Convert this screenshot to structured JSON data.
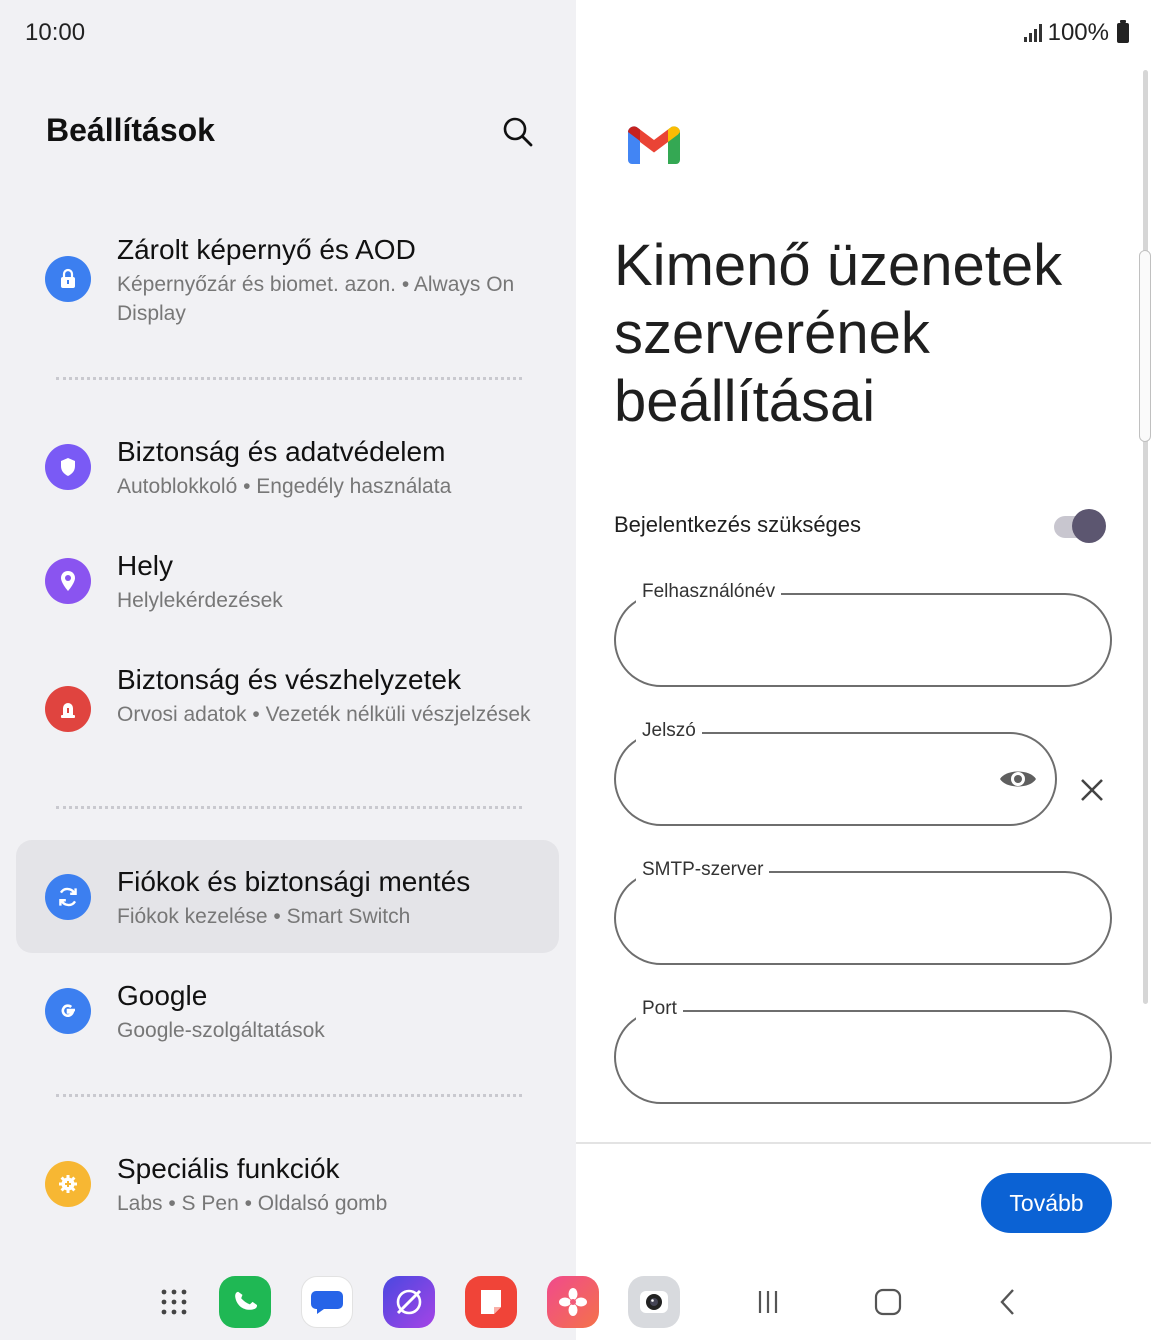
{
  "status_bar": {
    "time": "10:00",
    "battery": "100%"
  },
  "settings": {
    "title": "Beállítások",
    "items": [
      {
        "title": "Zárolt képernyő és AOD",
        "subtitle": "Képernyőzár és biomet. azon.  •  Always On Display",
        "icon": "lock-icon",
        "color": "#3c7ff0"
      },
      {
        "title": "Biztonság és adatvédelem",
        "subtitle": "Autoblokkoló  •  Engedély használata",
        "icon": "shield-icon",
        "color": "#7a5af5"
      },
      {
        "title": "Hely",
        "subtitle": "Helylekérdezések",
        "icon": "location-pin-icon",
        "color": "#8a54f0"
      },
      {
        "title": "Biztonság és vészhelyzetek",
        "subtitle": "Orvosi adatok  •  Vezeték nélküli vészjelzések",
        "icon": "emergency-light-icon",
        "color": "#e0443f"
      },
      {
        "title": "Fiókok és biztonsági mentés",
        "subtitle": "Fiókok kezelése  •  Smart Switch",
        "icon": "sync-icon",
        "color": "#3c7ff0"
      },
      {
        "title": "Google",
        "subtitle": "Google-szolgáltatások",
        "icon": "google-g-icon",
        "color": "#3c7ff0"
      },
      {
        "title": "Speciális funkciók",
        "subtitle": "Labs  •  S Pen  •  Oldalsó gomb",
        "icon": "gear-plus-icon",
        "color": "#f7b733"
      }
    ]
  },
  "gmail": {
    "logo": "gmail-logo-icon",
    "heading": "Kimenő üzenetek szerverének beállításai",
    "toggle_label": "Bejelentkezés szükséges",
    "toggle_on": true,
    "fields": {
      "username": {
        "label": "Felhasználónév",
        "value": ""
      },
      "password": {
        "label": "Jelszó",
        "value": ""
      },
      "smtp": {
        "label": "SMTP-szerver",
        "value": ""
      },
      "port": {
        "label": "Port",
        "value": ""
      }
    },
    "next_button": "Tovább"
  },
  "dock": {
    "apps": [
      "apps-grid-icon",
      "phone-icon",
      "messages-icon",
      "internet-icon",
      "notes-icon",
      "gallery-icon",
      "camera-icon"
    ],
    "nav": [
      "recents-icon",
      "home-icon",
      "back-icon"
    ]
  }
}
